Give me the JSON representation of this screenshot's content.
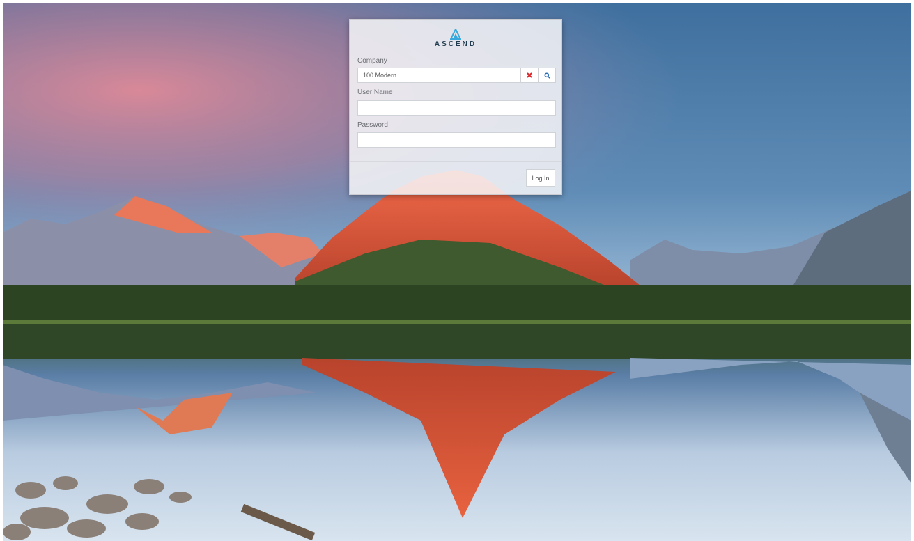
{
  "app": {
    "brand": "ASCEND"
  },
  "login": {
    "company_label": "Company",
    "company_value": "100 Modern",
    "username_label": "User Name",
    "username_value": "",
    "password_label": "Password",
    "password_value": "",
    "submit_label": "Log In"
  },
  "icons": {
    "brand": "ascend-logo-icon",
    "clear": "clear-x-icon",
    "search": "search-icon"
  },
  "colors": {
    "clear_icon": "#d9262b",
    "search_icon": "#2a6db5",
    "brand_text": "#1f3b4d",
    "brand_mark": "#38a9dc"
  }
}
